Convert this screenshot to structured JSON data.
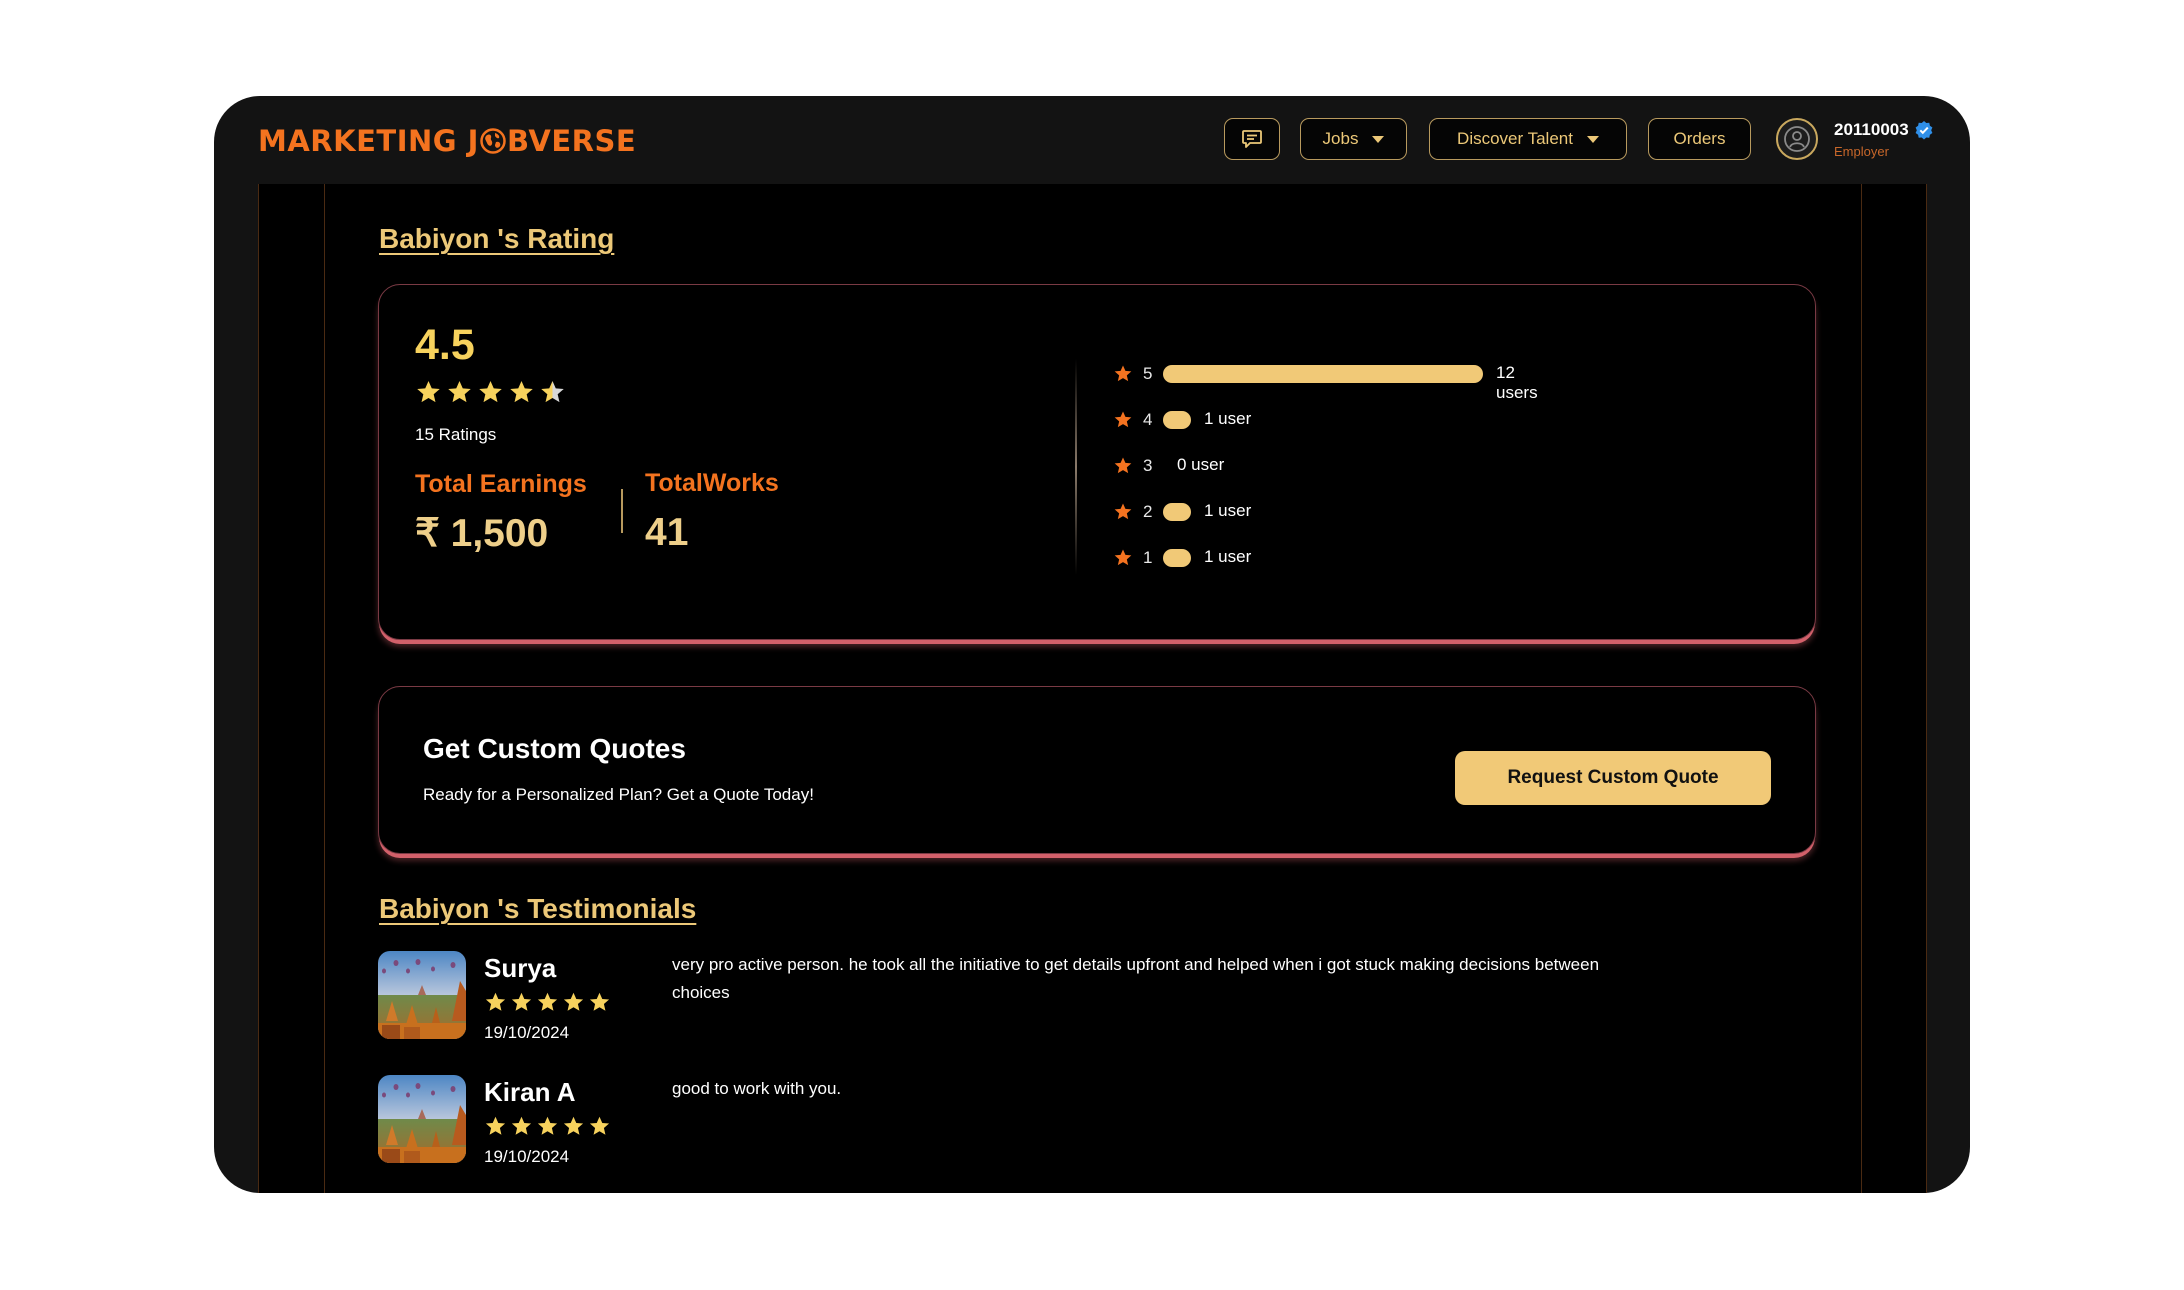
{
  "header": {
    "logo_text_left": "MARKETING J",
    "logo_text_right": "BVERSE",
    "logo_icon": "globe-icon",
    "chat_icon": "chat-icon",
    "nav": [
      {
        "label": "Jobs",
        "has_dropdown": true
      },
      {
        "label": "Discover Talent",
        "has_dropdown": true
      },
      {
        "label": "Orders",
        "has_dropdown": false
      }
    ],
    "user": {
      "id": "20110003",
      "role": "Employer",
      "verified": true,
      "avatar_icon": "user-circle-icon"
    }
  },
  "rating_section": {
    "title": "Babiyon 's Rating",
    "average": "4.5",
    "average_value": 4.5,
    "ratings_count": "15 Ratings",
    "earnings_label": "Total Earnings",
    "earnings_value": "₹ 1,500",
    "works_label": "TotalWorks",
    "works_value": "41",
    "distribution": [
      {
        "stars": "5",
        "count": 12,
        "label": "12 users"
      },
      {
        "stars": "4",
        "count": 1,
        "label": "1 user"
      },
      {
        "stars": "3",
        "count": 0,
        "label": "0 user"
      },
      {
        "stars": "2",
        "count": 1,
        "label": "1 user"
      },
      {
        "stars": "1",
        "count": 1,
        "label": "1 user"
      }
    ]
  },
  "quote_section": {
    "title": "Get Custom Quotes",
    "subtitle": "Ready for a Personalized Plan? Get a Quote Today!",
    "button_label": "Request Custom Quote"
  },
  "testimonials_section": {
    "title": "Babiyon 's Testimonials",
    "items": [
      {
        "name": "Surya",
        "rating": 5,
        "date": "19/10/2024",
        "text": "very pro active person. he took all the initiative to get details upfront and helped when i got stuck making decisions between choices"
      },
      {
        "name": "Kiran A",
        "rating": 5,
        "date": "19/10/2024",
        "text": "good to work with you."
      }
    ]
  },
  "colors": {
    "accent_orange": "#f4731f",
    "accent_gold": "#f1c977",
    "star_yellow": "#f7d25d",
    "card_glow": "#d2606a",
    "verified_blue": "#2f8fe8"
  }
}
